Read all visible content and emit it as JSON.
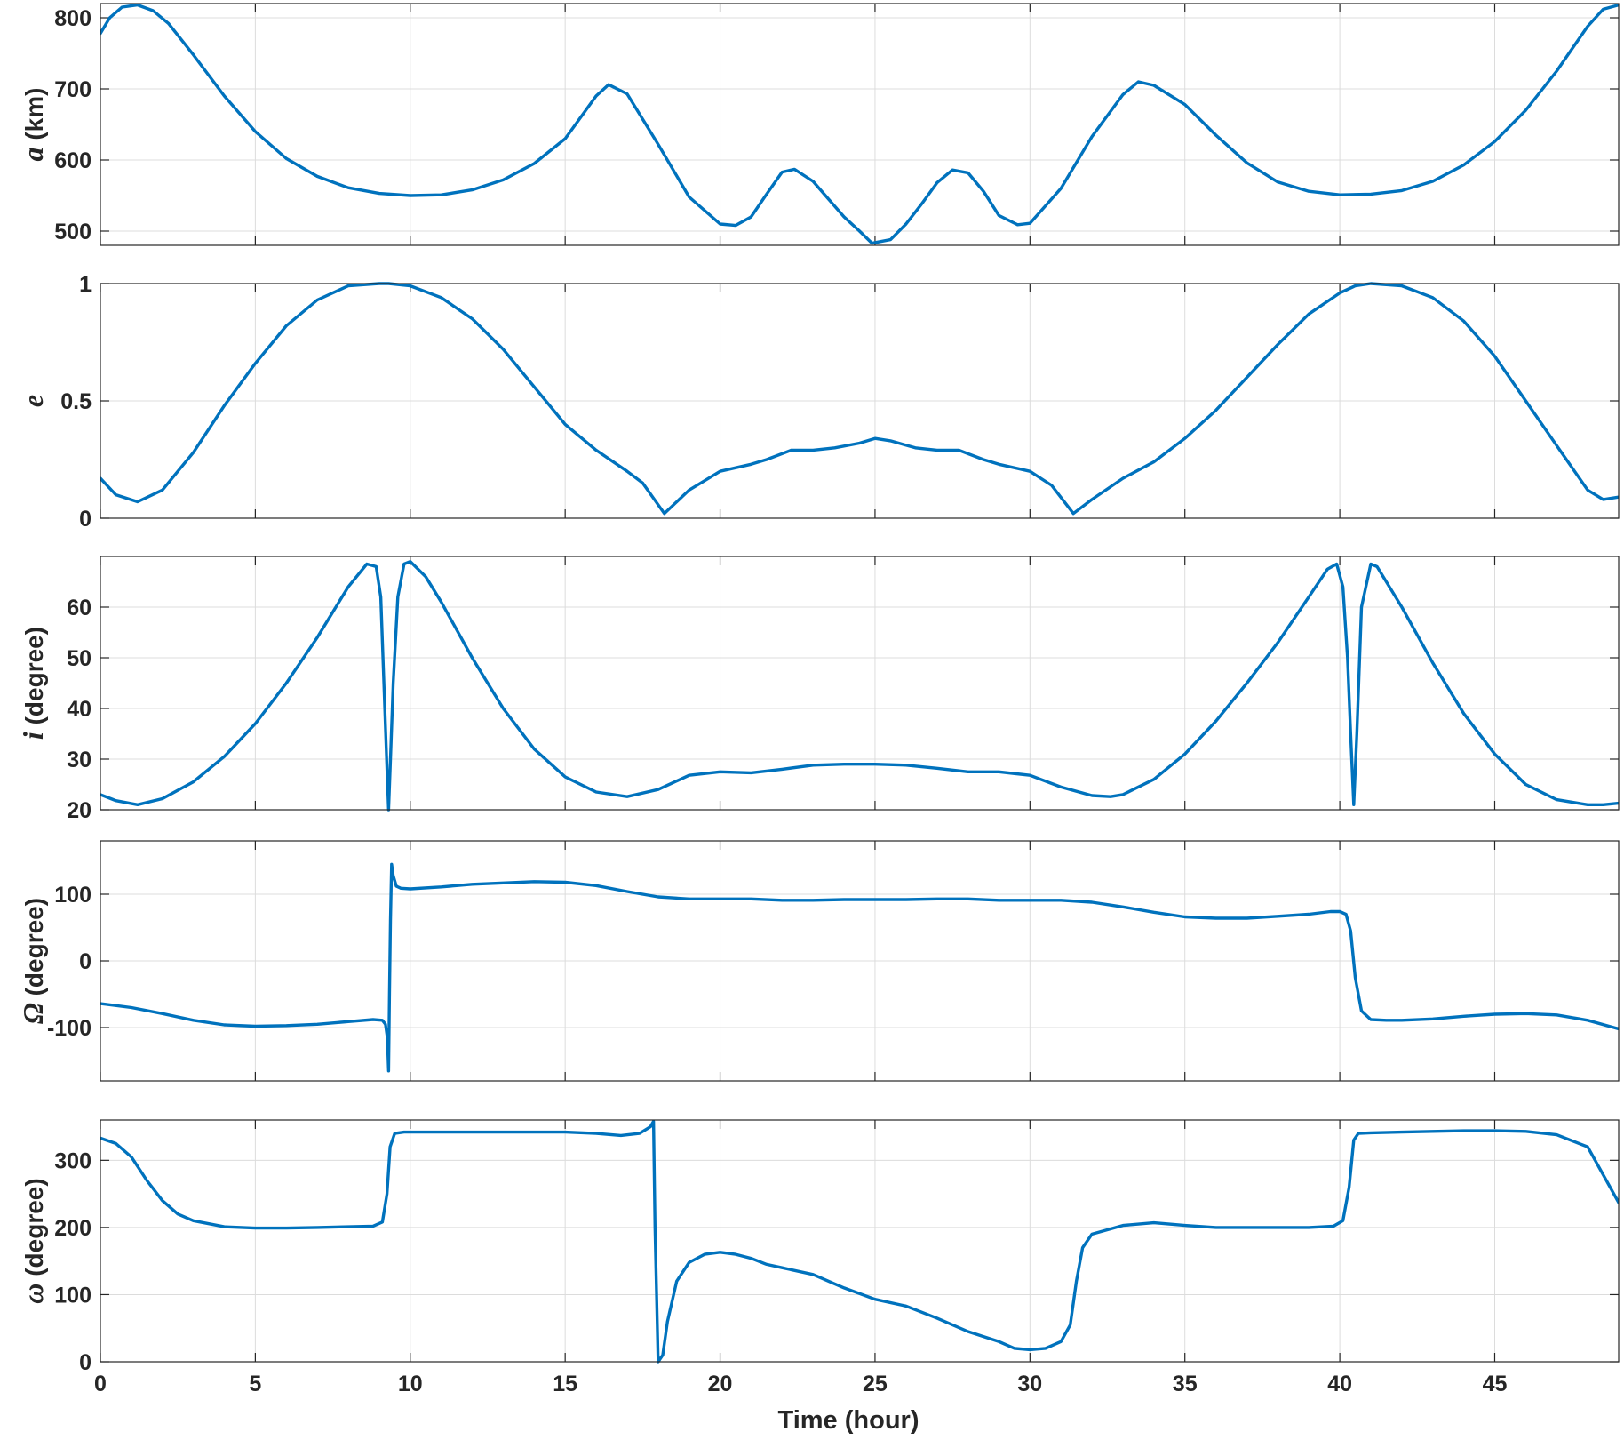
{
  "chart_data": [
    {
      "type": "line",
      "ylabel_symbol": "a",
      "ylabel_unit": " (km)",
      "xlim": [
        0,
        49
      ],
      "ylim": [
        480,
        820
      ],
      "yticks": [
        500,
        600,
        700,
        800
      ],
      "grid": true,
      "color": "#0072BD",
      "x": [
        0,
        0.3,
        0.7,
        1.2,
        1.7,
        2.2,
        3,
        4,
        5,
        6,
        7,
        8,
        9,
        10,
        11,
        12,
        13,
        14,
        15,
        16,
        16.4,
        17,
        18,
        19,
        20,
        20.5,
        21,
        21.5,
        22,
        22.4,
        23,
        23.5,
        24,
        24.5,
        24.9,
        25.5,
        26,
        26.5,
        27,
        27.5,
        28,
        28.5,
        29,
        29.6,
        30,
        31,
        32,
        33,
        33.5,
        34,
        35,
        36,
        37,
        38,
        39,
        40,
        41,
        42,
        43,
        44,
        45,
        46,
        47,
        48,
        48.5,
        49
      ],
      "y": [
        778,
        800,
        815,
        818,
        810,
        792,
        748,
        690,
        640,
        602,
        577,
        561,
        553,
        550,
        551,
        558,
        572,
        595,
        630,
        690,
        706,
        693,
        622,
        548,
        510,
        508,
        520,
        552,
        583,
        587,
        570,
        545,
        520,
        500,
        483,
        488,
        510,
        538,
        568,
        586,
        582,
        556,
        522,
        509,
        511,
        560,
        633,
        692,
        710,
        705,
        678,
        635,
        596,
        569,
        556,
        551,
        552,
        557,
        570,
        593,
        626,
        670,
        725,
        788,
        812,
        818
      ]
    },
    {
      "type": "line",
      "ylabel_symbol": "e",
      "ylabel_unit": "",
      "xlim": [
        0,
        49
      ],
      "ylim": [
        0,
        1
      ],
      "yticks": [
        0,
        0.5,
        1
      ],
      "grid": true,
      "color": "#0072BD",
      "x": [
        0,
        0.5,
        1.2,
        2,
        3,
        4,
        5,
        6,
        7,
        8,
        9,
        9.3,
        10,
        11,
        12,
        13,
        14,
        15,
        16,
        17,
        17.5,
        18.2,
        19,
        20,
        21,
        21.5,
        22.3,
        23,
        23.7,
        24.5,
        25,
        25.5,
        26.3,
        27,
        27.7,
        28.5,
        29,
        30,
        30.7,
        31.4,
        32,
        33,
        34,
        35,
        36,
        37,
        38,
        39,
        40,
        40.5,
        41,
        42,
        43,
        44,
        45,
        46,
        47,
        48,
        48.5,
        49
      ],
      "y": [
        0.17,
        0.1,
        0.07,
        0.12,
        0.28,
        0.48,
        0.66,
        0.82,
        0.93,
        0.99,
        1.0,
        1.0,
        0.99,
        0.94,
        0.85,
        0.72,
        0.56,
        0.4,
        0.29,
        0.2,
        0.15,
        0.02,
        0.12,
        0.2,
        0.23,
        0.25,
        0.29,
        0.29,
        0.3,
        0.32,
        0.34,
        0.33,
        0.3,
        0.29,
        0.29,
        0.25,
        0.23,
        0.2,
        0.14,
        0.02,
        0.08,
        0.17,
        0.24,
        0.34,
        0.46,
        0.6,
        0.74,
        0.87,
        0.96,
        0.99,
        1.0,
        0.99,
        0.94,
        0.84,
        0.69,
        0.5,
        0.31,
        0.12,
        0.08,
        0.09
      ]
    },
    {
      "type": "line",
      "ylabel_symbol": "i",
      "ylabel_unit": " (degree)",
      "xlim": [
        0,
        49
      ],
      "ylim": [
        20,
        70
      ],
      "yticks": [
        20,
        30,
        40,
        50,
        60
      ],
      "grid": true,
      "color": "#0072BD",
      "x": [
        0,
        0.5,
        1.2,
        2,
        3,
        4,
        5,
        6,
        7,
        8,
        8.6,
        8.9,
        9.05,
        9.15,
        9.25,
        9.3,
        9.35,
        9.45,
        9.6,
        9.8,
        10,
        10.5,
        11,
        12,
        13,
        14,
        15,
        16,
        17,
        18,
        19,
        20,
        21,
        22,
        23,
        24,
        25,
        26,
        27,
        28,
        29,
        30,
        31,
        32,
        32.6,
        33,
        34,
        35,
        36,
        37,
        38,
        39,
        39.6,
        39.9,
        40.1,
        40.25,
        40.35,
        40.45,
        40.55,
        40.7,
        41,
        41.2,
        42,
        43,
        44,
        45,
        46,
        47,
        48,
        48.5,
        49
      ],
      "y": [
        23,
        21.8,
        21,
        22.2,
        25.5,
        30.5,
        37,
        45,
        54,
        64,
        68.5,
        68,
        62,
        45,
        28,
        20,
        28,
        45,
        62,
        68.5,
        69,
        66,
        61,
        50,
        40,
        32,
        26.5,
        23.5,
        22.6,
        24,
        26.8,
        27.5,
        27.3,
        28,
        28.8,
        29,
        29,
        28.8,
        28.2,
        27.5,
        27.5,
        26.8,
        24.5,
        22.8,
        22.6,
        23,
        26,
        31,
        37.5,
        45,
        53,
        62,
        67.5,
        68.5,
        64,
        50,
        35,
        21,
        35,
        60,
        68.5,
        68,
        60,
        49,
        39,
        31,
        25,
        22,
        21,
        21,
        21.3
      ]
    },
    {
      "type": "line",
      "ylabel_symbol": "Ω",
      "ylabel_unit": " (degree)",
      "xlim": [
        0,
        49
      ],
      "ylim": [
        -180,
        180
      ],
      "yticks": [
        -100,
        0,
        100
      ],
      "grid": true,
      "color": "#0072BD",
      "x": [
        0,
        1,
        2,
        3,
        4,
        5,
        6,
        7,
        8,
        8.8,
        9.1,
        9.2,
        9.26,
        9.3,
        9.33,
        9.36,
        9.4,
        9.45,
        9.55,
        9.7,
        10,
        11,
        12,
        13,
        14,
        15,
        16,
        17,
        18,
        19,
        20,
        21,
        22,
        23,
        24,
        25,
        26,
        27,
        28,
        29,
        30,
        31,
        32,
        33,
        34,
        35,
        36,
        37,
        38,
        39,
        39.7,
        40,
        40.2,
        40.35,
        40.5,
        40.7,
        41,
        41.5,
        42,
        43,
        44,
        45,
        46,
        47,
        48,
        49
      ],
      "y": [
        -64,
        -70,
        -79,
        -89,
        -96,
        -98,
        -97,
        -95,
        -91,
        -88,
        -89,
        -95,
        -115,
        -165,
        -50,
        60,
        145,
        128,
        112,
        109,
        108,
        111,
        115,
        117,
        119,
        118,
        113,
        104,
        96,
        93,
        93,
        93,
        91,
        91,
        92,
        92,
        92,
        93,
        93,
        91,
        91,
        91,
        88,
        81,
        73,
        66,
        64,
        64,
        67,
        70,
        74,
        74,
        70,
        45,
        -25,
        -75,
        -88,
        -89,
        -89,
        -87,
        -83,
        -80,
        -79,
        -81,
        -89,
        -102
      ]
    },
    {
      "type": "line",
      "ylabel_symbol": "ω",
      "ylabel_unit": " (degree)",
      "xlim": [
        0,
        49
      ],
      "ylim": [
        0,
        360
      ],
      "yticks": [
        0,
        100,
        200,
        300
      ],
      "grid": true,
      "color": "#0072BD",
      "x": [
        0,
        0.5,
        1,
        1.5,
        2,
        2.5,
        3,
        4,
        5,
        6,
        7,
        8,
        8.8,
        9.1,
        9.25,
        9.35,
        9.5,
        9.8,
        10,
        12,
        14,
        15,
        16,
        16.8,
        17.4,
        17.75,
        17.85,
        17.9,
        18,
        18.15,
        18.3,
        18.6,
        19,
        19.5,
        20,
        20.5,
        21,
        21.5,
        22,
        23,
        24,
        25,
        26,
        27,
        28,
        29,
        29.5,
        30,
        30.5,
        31,
        31.3,
        31.5,
        31.7,
        32,
        33,
        34,
        35,
        36,
        37,
        38,
        39,
        39.8,
        40.1,
        40.3,
        40.45,
        40.6,
        41,
        42,
        43,
        44,
        45,
        46,
        47,
        48,
        49
      ],
      "y": [
        333,
        325,
        305,
        270,
        240,
        220,
        210,
        201,
        199,
        199,
        200,
        201,
        202,
        208,
        250,
        320,
        340,
        342,
        342,
        342,
        342,
        342,
        340,
        337,
        340,
        350,
        358,
        200,
        0,
        10,
        60,
        120,
        148,
        160,
        163,
        160,
        154,
        145,
        140,
        130,
        110,
        93,
        83,
        65,
        45,
        30,
        20,
        18,
        20,
        30,
        55,
        120,
        170,
        190,
        203,
        207,
        203,
        200,
        200,
        200,
        200,
        202,
        210,
        260,
        330,
        340,
        341,
        342,
        343,
        344,
        344,
        343,
        338,
        320,
        237
      ]
    }
  ],
  "x_axis": {
    "label": "Time (hour)",
    "ticks": [
      0,
      5,
      10,
      15,
      20,
      25,
      30,
      35,
      40,
      45
    ]
  }
}
